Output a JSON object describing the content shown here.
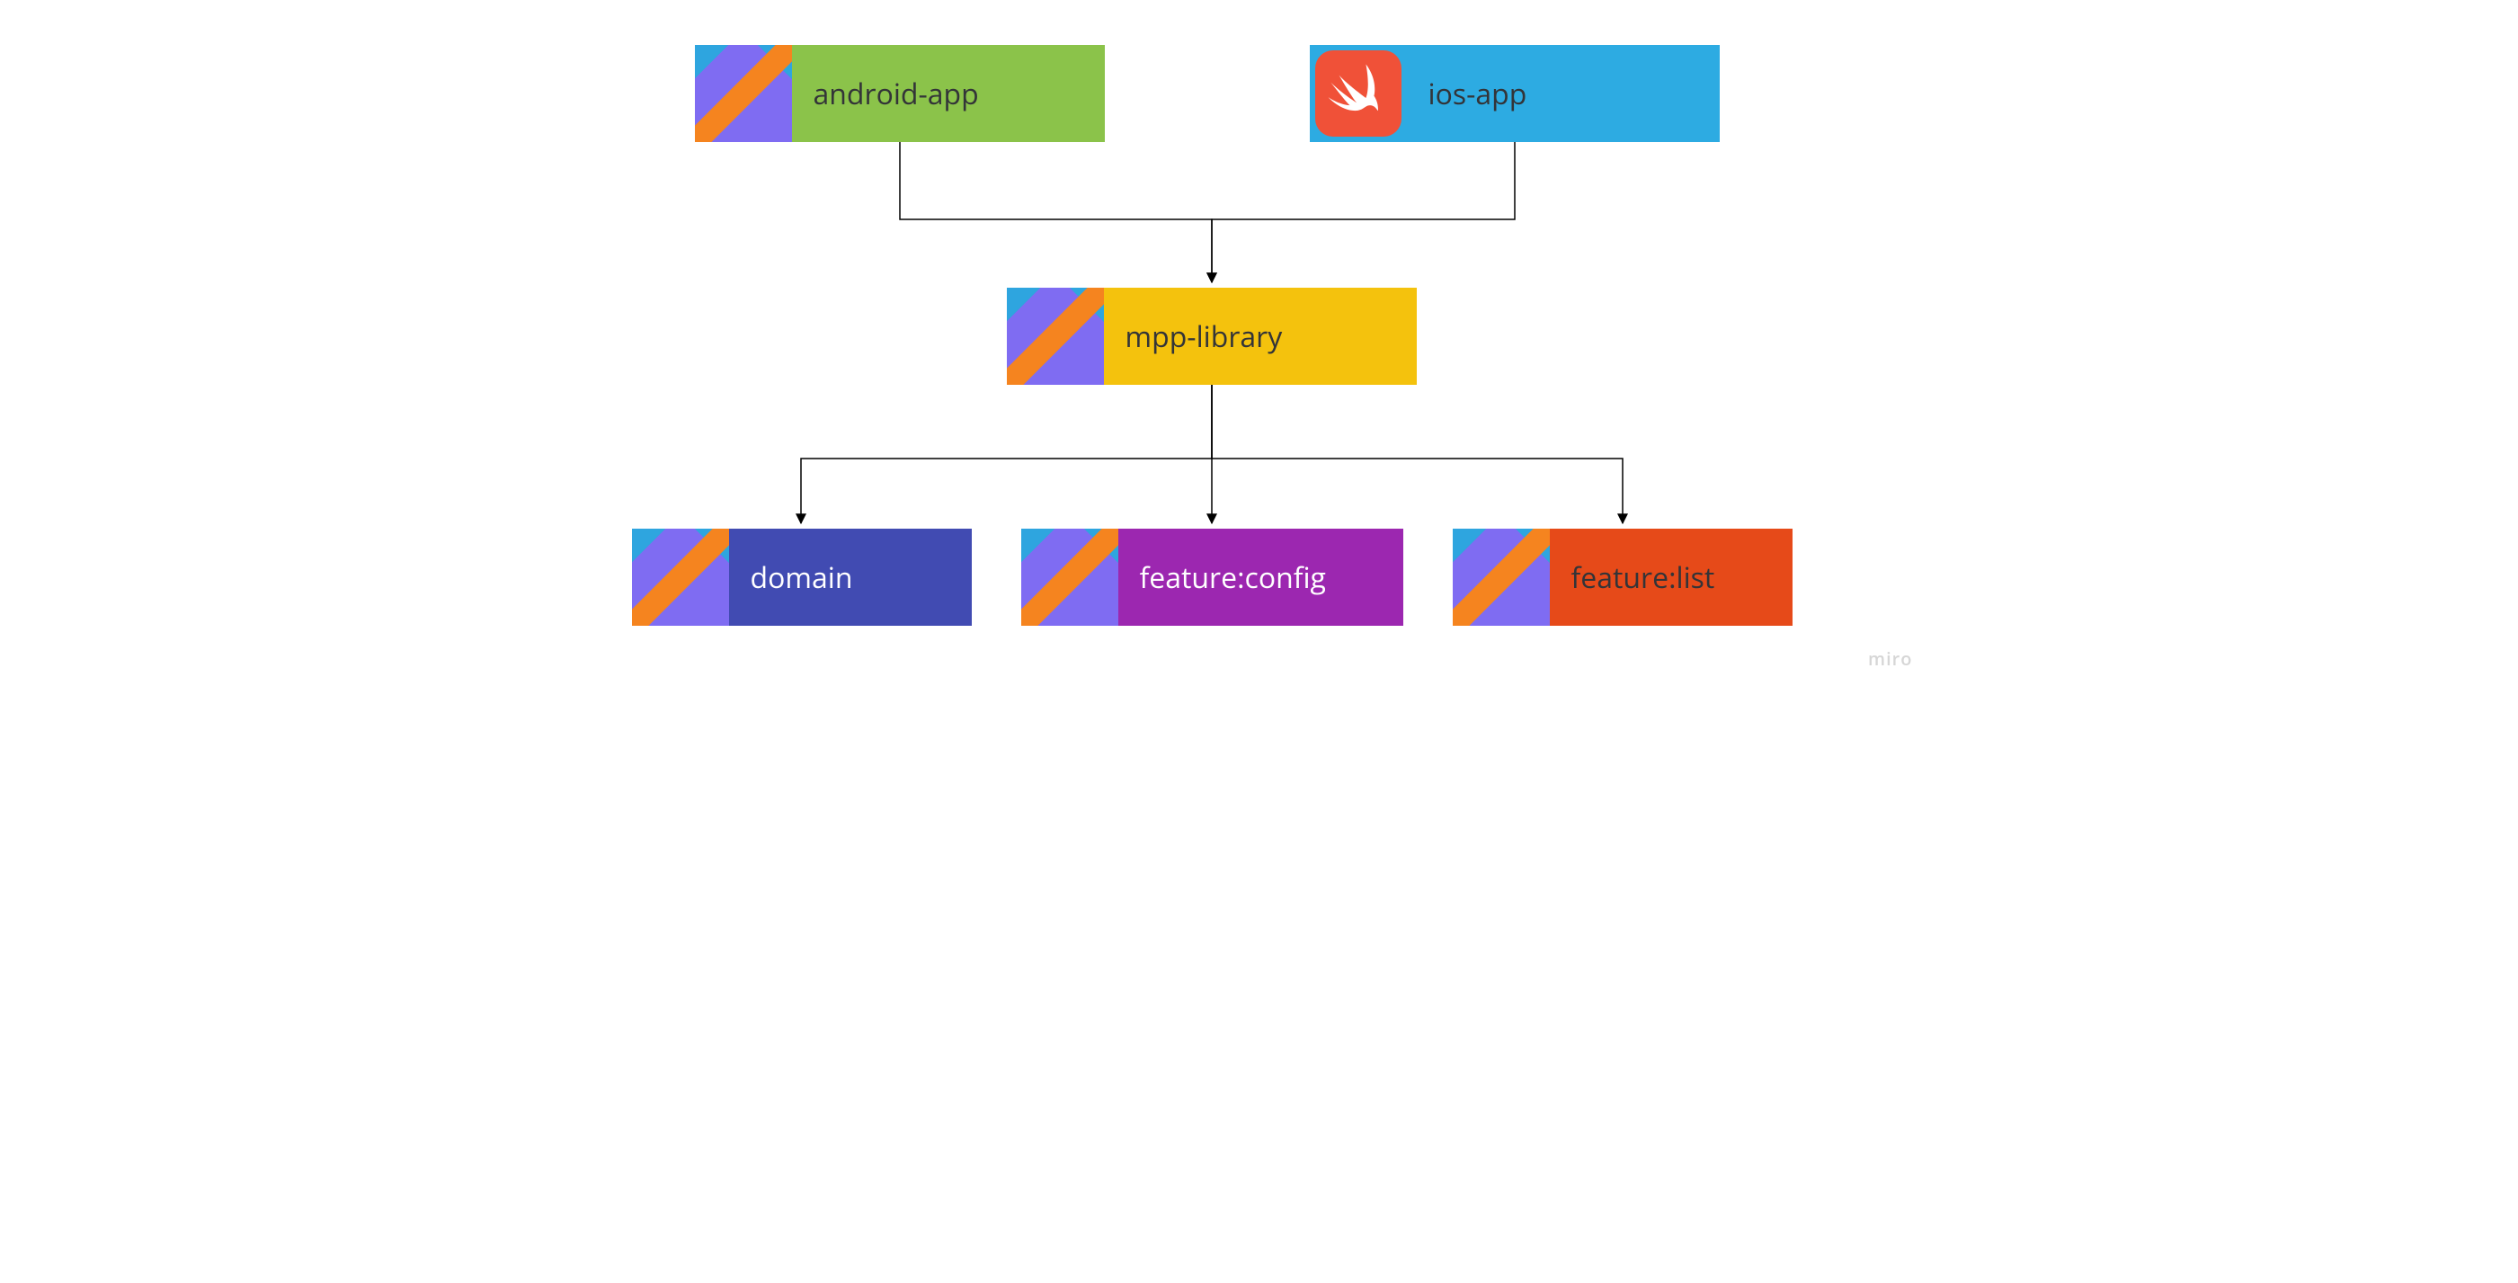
{
  "nodes": {
    "android": {
      "label": "android-app",
      "icon": "kotlin",
      "bg": "#8bc34a",
      "text": "dark"
    },
    "ios": {
      "label": "ios-app",
      "icon": "swift",
      "bg": "#2dabe2",
      "text": "dark"
    },
    "mpp": {
      "label": "mpp-library",
      "icon": "kotlin",
      "bg": "#f4c20d",
      "text": "dark"
    },
    "domain": {
      "label": "domain",
      "icon": "kotlin",
      "bg": "#414bb2",
      "text": "white"
    },
    "config": {
      "label": "feature:config",
      "icon": "kotlin",
      "bg": "#9c27b0",
      "text": "white"
    },
    "list": {
      "label": "feature:list",
      "icon": "kotlin",
      "bg": "#e64a19",
      "text": "dark"
    }
  },
  "edges": [
    {
      "from": "android",
      "to": "mpp"
    },
    {
      "from": "ios",
      "to": "mpp"
    },
    {
      "from": "mpp",
      "to": "domain"
    },
    {
      "from": "mpp",
      "to": "config"
    },
    {
      "from": "mpp",
      "to": "list"
    }
  ],
  "watermark": "miro"
}
